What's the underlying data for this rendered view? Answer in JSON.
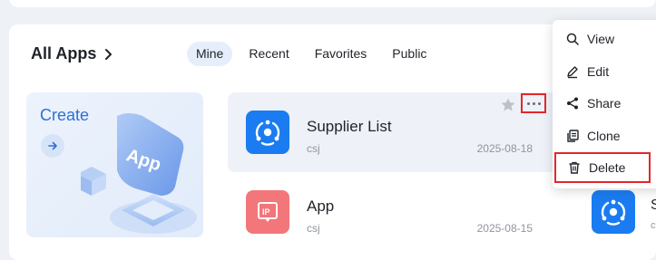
{
  "section": {
    "title": "All Apps"
  },
  "tabs": [
    {
      "label": "Mine",
      "active": true
    },
    {
      "label": "Recent",
      "active": false
    },
    {
      "label": "Favorites",
      "active": false
    },
    {
      "label": "Public",
      "active": false
    }
  ],
  "create_card": {
    "label": "Create",
    "art_text": "App"
  },
  "apps": [
    {
      "name": "Supplier List",
      "owner": "csj",
      "date": "2025-08-18",
      "icon": "supplier-app-icon",
      "color": "#1a7cf0"
    },
    {
      "name": "App",
      "owner": "csj",
      "date": "2025-08-15",
      "icon": "ip-app-icon",
      "color": "#f2767a"
    }
  ],
  "context_menu": {
    "items": [
      {
        "label": "View",
        "icon": "search-icon"
      },
      {
        "label": "Edit",
        "icon": "pen-icon"
      },
      {
        "label": "Share",
        "icon": "share-icon"
      },
      {
        "label": "Clone",
        "icon": "clone-icon"
      },
      {
        "label": "Delete",
        "icon": "trash-icon"
      }
    ]
  },
  "peek_app": {
    "name_fragment": "S",
    "owner_fragment": "c"
  },
  "colors": {
    "accent": "#2f6fd6",
    "highlight_border": "#e3262c",
    "active_tab_bg": "#e6eefb"
  }
}
